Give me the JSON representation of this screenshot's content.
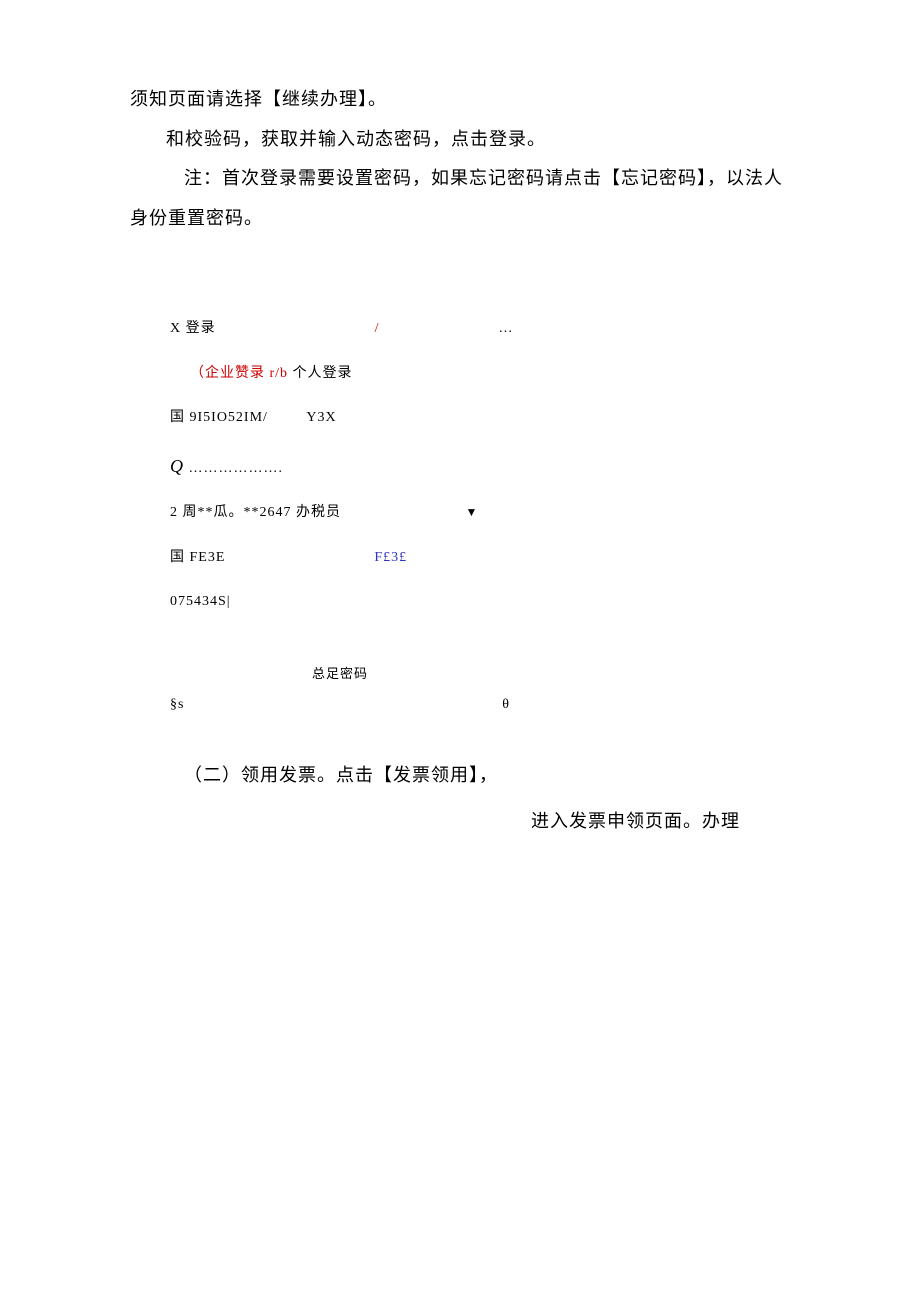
{
  "paragraphs": {
    "p1": "须知页面请选择【继续办理】。",
    "p2": "和校验码，获取并输入动态密码，点击登录。",
    "p3": "注：首次登录需要设置密码，如果忘记密码请点击【忘记密码】，以法人身份重置密码。"
  },
  "login": {
    "header_prefix": "X 登录",
    "header_slash": "/",
    "header_dots": "…",
    "tab_enterprise_open": "（企业赞录",
    "tab_enterprise_red": "r/b",
    "tab_personal": "个人登录",
    "field1_label": "国",
    "field1_value": "9I5IO52IM/",
    "field1_suffix": "Y3X",
    "password_symbol": "Q",
    "password_dots": "……………….",
    "user_row": "2 周**瓜。**2647 办税员",
    "code_label": "国",
    "code_value": "FE3E",
    "code_image_text": "F£3£",
    "dynamic_code": "075434S|",
    "forgot_label": "总足密码",
    "footer_left": "§s",
    "footer_right": "θ"
  },
  "section_two": {
    "line1": "（二）领用发票。点击【发票领用】，",
    "line2": "进入发票申领页面。办理"
  }
}
